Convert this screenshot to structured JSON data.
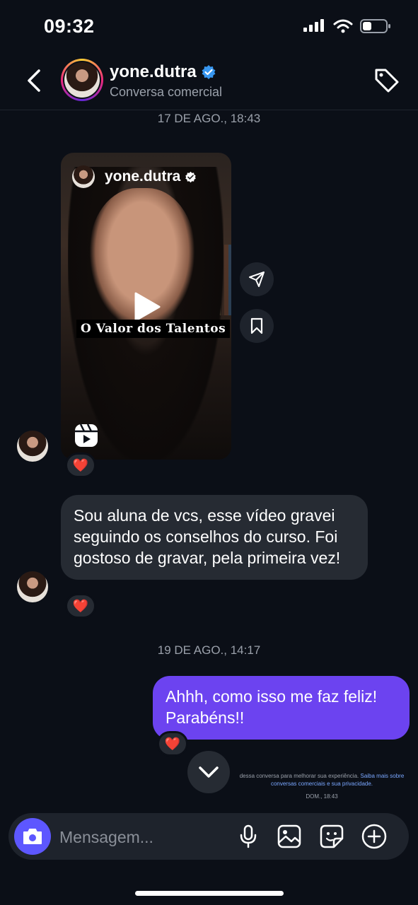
{
  "status_bar": {
    "time": "09:32"
  },
  "header": {
    "username": "yone.dutra",
    "subtitle": "Conversa comercial",
    "icons": {
      "back": "chevron-left-icon",
      "verified": "verified-badge-icon",
      "tag": "tag-icon"
    }
  },
  "thread": {
    "date_1": "17 DE AGO., 18:43",
    "reel": {
      "username": "yone.dutra",
      "caption": "O Valor dos Talentos",
      "reaction": "❤️"
    },
    "message_in": {
      "text": "Sou aluna de vcs, esse vídeo gravei seguindo os conselhos do curso. Foi gostoso de gravar, pela primeira vez!",
      "reaction": "❤️"
    },
    "date_2": "19 DE AGO., 14:17",
    "message_out": {
      "text": "Ahhh, como isso me faz feliz! Parabéns!!",
      "reaction": "❤️"
    },
    "notice": {
      "text": "dessa conversa para melhorar sua experiência.",
      "link": "Saiba mais sobre conversas comerciais e sua privacidade.",
      "date": "DOM., 18:43"
    }
  },
  "composer": {
    "placeholder": "Mensagem...",
    "icons": [
      "camera-icon",
      "microphone-icon",
      "image-icon",
      "sticker-icon",
      "plus-icon"
    ]
  },
  "colors": {
    "background": "#0b0f17",
    "bubble_in": "#262b33",
    "bubble_out": "#6c43f0",
    "camera": "#5d57ff",
    "verified": "#3897f0"
  }
}
